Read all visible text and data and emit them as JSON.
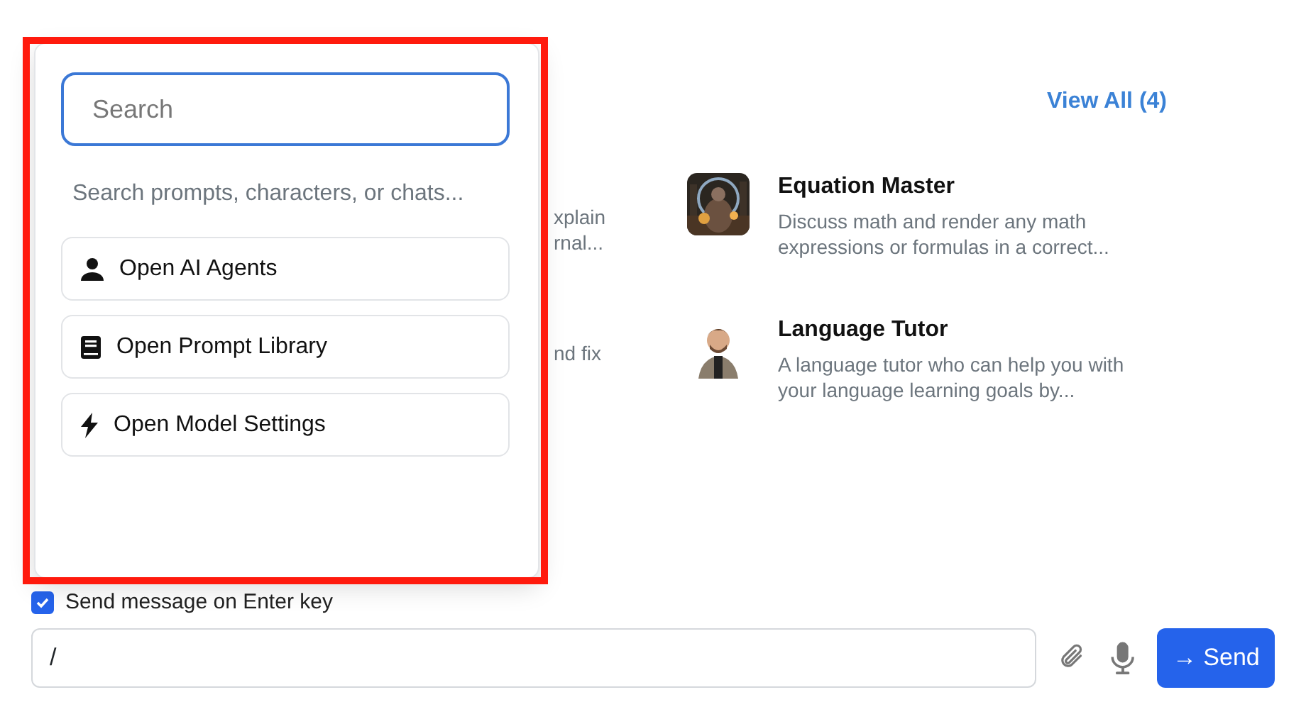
{
  "view_all_link": "View All (4)",
  "hidden_cards": [
    {
      "lines": [
        "xplain",
        "rnal..."
      ]
    },
    {
      "lines": [
        "nd fix"
      ]
    }
  ],
  "cards": [
    {
      "title": "Equation Master",
      "description": [
        "Discuss math and render any math",
        "expressions or formulas in a correct..."
      ],
      "picture": {
        "kind": "picture"
      }
    },
    {
      "title": "Language Tutor",
      "description": [
        "A language tutor who can help you with",
        "your language learning goals by..."
      ],
      "picture": {
        "kind": "picture"
      }
    }
  ],
  "send_on_enter": {
    "label": "Send message on Enter key",
    "checked": true
  },
  "message_input": {
    "value": "/"
  },
  "send_button": {
    "arrow": "→",
    "label": "Send"
  },
  "command_popup": {
    "search": {
      "placeholder": "Search"
    },
    "hint": "Search prompts, characters, or chats...",
    "items": [
      {
        "kind": "person",
        "label": "Open AI Agents"
      },
      {
        "kind": "book",
        "label": "Open Prompt Library"
      },
      {
        "kind": "bolt",
        "label": "Open Model Settings"
      }
    ]
  },
  "highlight_frame": {
    "color": "#ff1a0d"
  }
}
